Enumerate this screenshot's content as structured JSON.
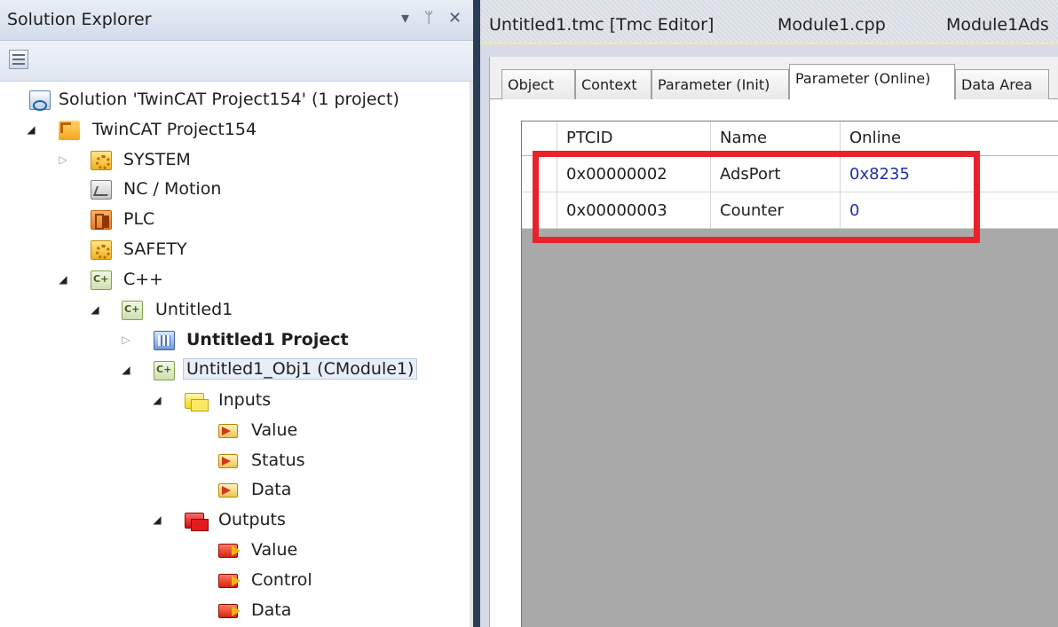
{
  "solution_explorer": {
    "title": "Solution Explorer",
    "controls": {
      "dropdown": "▾",
      "pin": "1̸",
      "close": "✕"
    },
    "tree": [
      {
        "id": "solution",
        "label": "Solution 'TwinCAT Project154' (1 project)",
        "icon": "solution-icon",
        "expander": "none"
      },
      {
        "id": "project",
        "label": "TwinCAT Project154",
        "icon": "twincat-project-icon",
        "expander": "open"
      },
      {
        "id": "system",
        "label": "SYSTEM",
        "icon": "system-gear-icon",
        "expander": "closed"
      },
      {
        "id": "nc-motion",
        "label": "NC / Motion",
        "icon": "nc-motion-icon",
        "expander": "none"
      },
      {
        "id": "plc",
        "label": "PLC",
        "icon": "plc-icon",
        "expander": "none"
      },
      {
        "id": "safety",
        "label": "SAFETY",
        "icon": "safety-gear-icon",
        "expander": "none"
      },
      {
        "id": "cpp",
        "label": "C++",
        "icon": "cpp-icon",
        "expander": "open"
      },
      {
        "id": "untitled1",
        "label": "Untitled1",
        "icon": "cpp-icon",
        "expander": "open"
      },
      {
        "id": "untitled1-project",
        "label": "Untitled1 Project",
        "icon": "vs-project-icon",
        "expander": "closed"
      },
      {
        "id": "untitled1-obj1",
        "label": "Untitled1_Obj1 (CModule1)",
        "icon": "cpp-icon",
        "expander": "open"
      },
      {
        "id": "inputs",
        "label": "Inputs",
        "icon": "inputs-folder-icon",
        "expander": "open"
      },
      {
        "id": "in-value",
        "label": "Value",
        "icon": "input-var-icon",
        "expander": "none"
      },
      {
        "id": "in-status",
        "label": "Status",
        "icon": "input-var-icon",
        "expander": "none"
      },
      {
        "id": "in-data",
        "label": "Data",
        "icon": "input-var-icon",
        "expander": "none"
      },
      {
        "id": "outputs",
        "label": "Outputs",
        "icon": "outputs-folder-icon",
        "expander": "open"
      },
      {
        "id": "out-value",
        "label": "Value",
        "icon": "output-var-icon",
        "expander": "none"
      },
      {
        "id": "out-control",
        "label": "Control",
        "icon": "output-var-icon",
        "expander": "none"
      },
      {
        "id": "out-data",
        "label": "Data",
        "icon": "output-var-icon",
        "expander": "none"
      }
    ]
  },
  "editor": {
    "doc_tabs": [
      "Untitled1.tmc [Tmc Editor]",
      "Module1.cpp",
      "Module1Ads"
    ],
    "inner_tabs": [
      "Object",
      "Context",
      "Parameter (Init)",
      "Parameter (Online)",
      "Data Area"
    ],
    "active_inner_tab": "Parameter (Online)",
    "grid": {
      "headers": [
        "PTCID",
        "Name",
        "Online"
      ],
      "rows": [
        [
          "0x00000002",
          "AdsPort",
          "0x8235"
        ],
        [
          "0x00000003",
          "Counter",
          "0"
        ]
      ]
    }
  },
  "colors": {
    "highlight": "#e8222a",
    "online_value": "#1d2ea8",
    "panel_background": "#2b3c59"
  }
}
